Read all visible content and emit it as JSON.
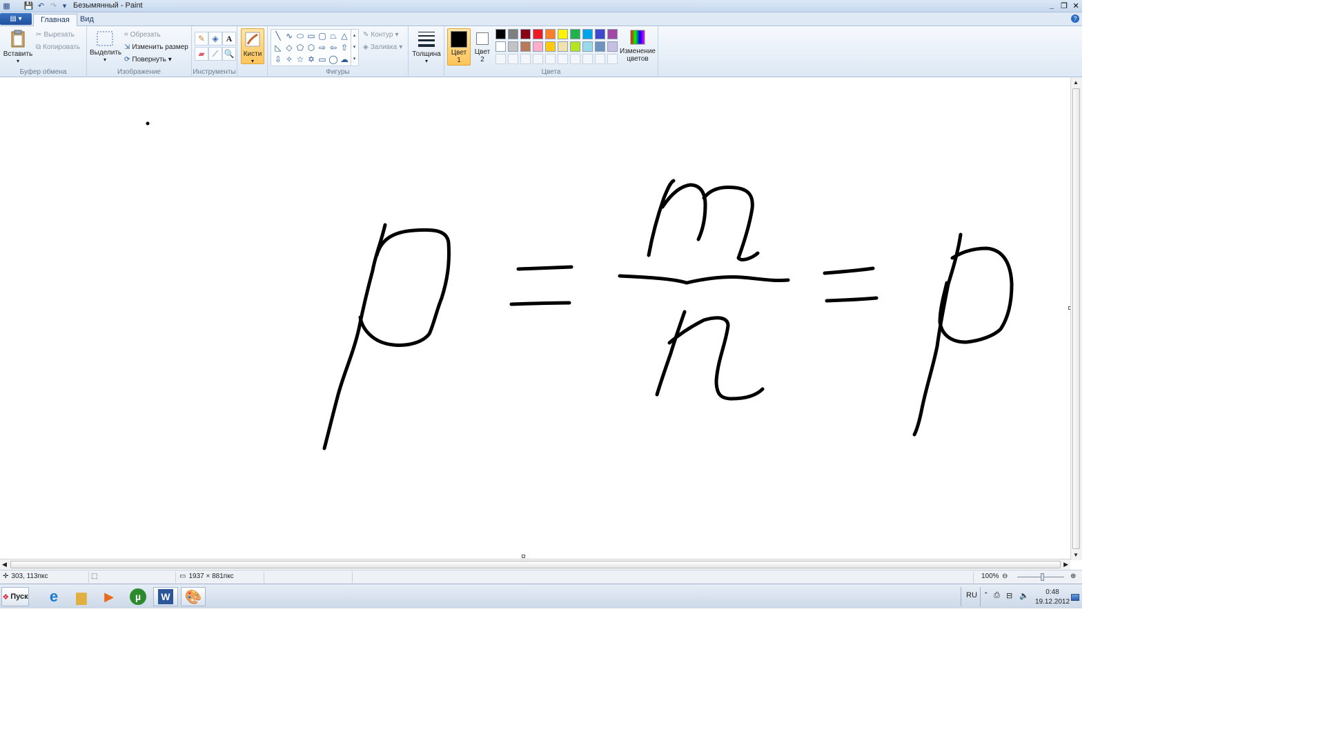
{
  "window": {
    "title": "Безымянный - Paint"
  },
  "ribbon": {
    "tabs": [
      "Главная",
      "Вид"
    ],
    "clipboard": {
      "group_label": "Буфер обмена",
      "paste": "Вставить",
      "cut": "Вырезать",
      "copy": "Копировать"
    },
    "image": {
      "group_label": "Изображение",
      "select": "Выделить",
      "crop": "Обрезать",
      "resize": "Изменить размер",
      "rotate": "Повернуть"
    },
    "tools": {
      "group_label": "Инструменты"
    },
    "brushes": {
      "label": "Кисти"
    },
    "shapes": {
      "group_label": "Фигуры",
      "outline": "Контур",
      "fill": "Заливка"
    },
    "size": {
      "label": "Толщина"
    },
    "colors": {
      "group_label": "Цвета",
      "color1_line1": "Цвет",
      "color1_line2": "1",
      "color2_line1": "Цвет",
      "color2_line2": "2",
      "edit_line1": "Изменение",
      "edit_line2": "цветов",
      "color1": "#000000",
      "color2": "#ffffff",
      "palette_row1": [
        "#000000",
        "#7f7f7f",
        "#880015",
        "#ed1c24",
        "#ff7f27",
        "#fff200",
        "#22b14c",
        "#00a2e8",
        "#3f48cc",
        "#a349a4"
      ],
      "palette_row2": [
        "#ffffff",
        "#c3c3c3",
        "#b97a57",
        "#ffaec9",
        "#ffc90e",
        "#efe4b0",
        "#b5e61d",
        "#99d9ea",
        "#7092be",
        "#c8bfe7"
      ]
    }
  },
  "statusbar": {
    "cursor_pos": "303, 113пкс",
    "canvas_size": "1937 × 881пкс",
    "zoom": "100%"
  },
  "taskbar": {
    "start_label": "Пуск",
    "lang": "RU",
    "time": "0:48",
    "date": "19.12.2012"
  }
}
